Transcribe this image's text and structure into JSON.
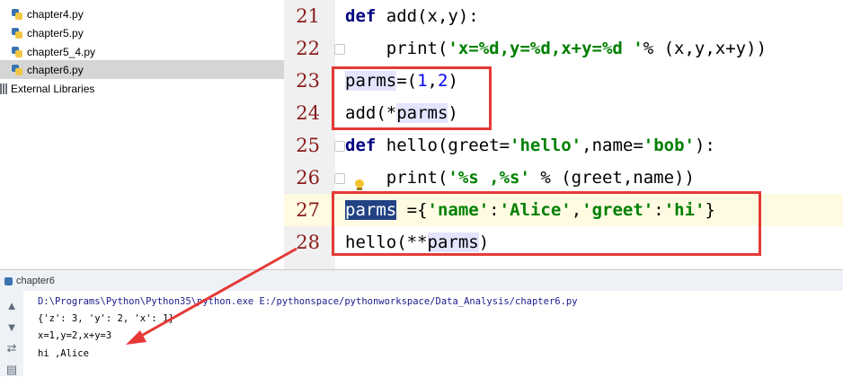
{
  "tree": {
    "items": [
      {
        "label": "chapter4.py",
        "type": "py"
      },
      {
        "label": "chapter5.py",
        "type": "py"
      },
      {
        "label": "chapter5_4.py",
        "type": "py"
      },
      {
        "label": "chapter6.py",
        "type": "py",
        "selected": true
      },
      {
        "label": "External Libraries",
        "type": "lib"
      }
    ]
  },
  "editor": {
    "lines": [
      {
        "n": "21",
        "code": "def add(x,y):"
      },
      {
        "n": "22",
        "code": "    print('x=%d,y=%d,x+y=%d '% (x,y,x+y))"
      },
      {
        "n": "23",
        "code": "parms=(1,2)"
      },
      {
        "n": "24",
        "code": "add(*parms)"
      },
      {
        "n": "25",
        "code": "def hello(greet='hello',name='bob'):"
      },
      {
        "n": "26",
        "code": "    print('%s ,%s' % (greet,name))"
      },
      {
        "n": "27",
        "code": "parms ={'name':'Alice','greet':'hi'}"
      },
      {
        "n": "28",
        "code": "hello(**parms)"
      }
    ],
    "current_line": "27"
  },
  "run": {
    "tab_title": "chapter6",
    "output": [
      "D:\\Programs\\Python\\Python35\\python.exe E:/pythonspace/pythonworkspace/Data_Analysis/chapter6.py",
      "{'z': 3, 'y': 2, 'x': 1}",
      "x=1,y=2,x+y=3",
      "hi ,Alice"
    ],
    "toolbar_icons": [
      "arrow-up-icon",
      "arrow-down-icon",
      "soft-wrap-icon",
      "print-icon"
    ]
  },
  "colors": {
    "annotation_red": "#e53935",
    "keyword": "#000080",
    "string": "#008000",
    "number": "#0000ff",
    "line_number": "#8a1b1b"
  }
}
